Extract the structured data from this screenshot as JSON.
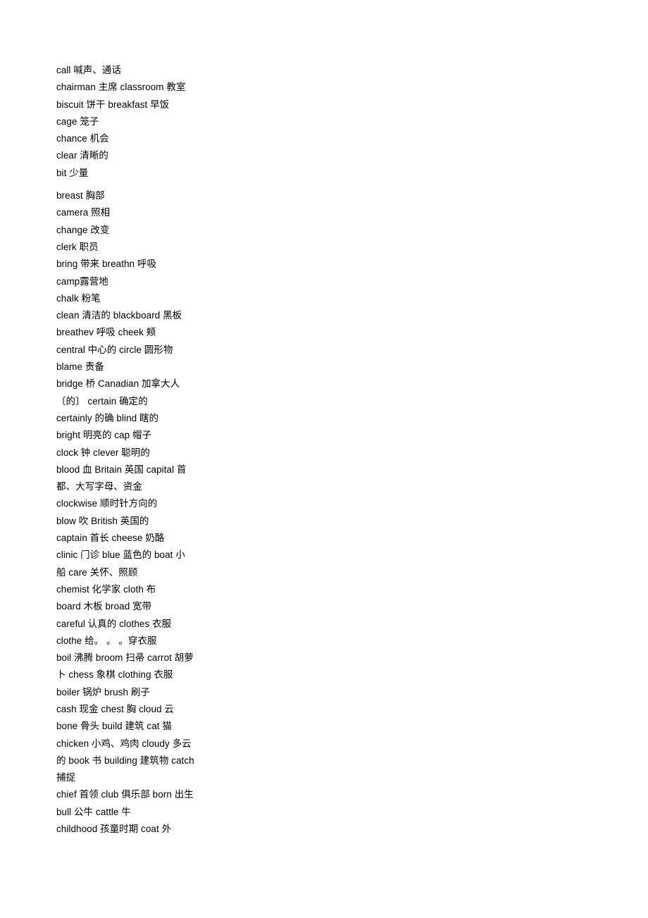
{
  "document": {
    "type": "vocabulary-word-list",
    "language_pair": "English-Chinese",
    "background_color": "#ffffff",
    "text_color": "#000000",
    "blocks": [
      {
        "id": "block-1",
        "lines": [
          "call 喊声、通话",
          "chairman 主席  classroom 教室  biscuit 饼干  breakfast 早饭",
          "cage 笼子",
          "chance 机会",
          "clear 清晰的",
          "bit 少量"
        ]
      },
      {
        "id": "block-2",
        "lines": [
          "breast 胸部",
          "camera 照相",
          "change 改变",
          "clerk 职员",
          "bring 带来  breathn 呼吸",
          "camp露营地",
          "chalk 粉笔",
          "clean 清洁的  blackboard 黑板  breathev 呼吸  cheek 颊",
          "central 中心的  circle 圆形物",
          "blame 责备",
          "bridge 桥  Canadian 加拿大人〔的〕  certain 确定的",
          "certainly 的确  blind 瞎的",
          "bright 明亮的  cap 帽子",
          "clock 钟  clever 聪明的",
          "blood 血  Britain 英国  capital 首都、大写字母、资金",
          "clockwise 顺时针方向的",
          "blow 吹  British 英国的",
          "captain 首长  cheese 奶酪",
          "clinic 门诊  blue 蓝色的  boat 小船  care 关怀、照顾",
          "chemist 化学家  cloth 布",
          "board 木板  broad 宽带",
          "careful 认真的  clothes 衣服",
          "clothe 给。 。 。穿衣服",
          "boil 沸腾  broom 扫帚  carrot 胡萝卜  chess 象棋  clothing 衣服  boiler 锅炉  brush 刷子",
          "cash 现金  chest 胸  cloud 云",
          "bone 骨头  build 建筑  cat 猫",
          "chicken 小鸡、鸡肉  cloudy 多云的  book 书  building 建筑物  catch 捕捉",
          "chief 首领  club 俱乐部  born 出生  bull 公牛  cattle 牛",
          "childhood 孩童时期  coat 外"
        ]
      }
    ]
  }
}
